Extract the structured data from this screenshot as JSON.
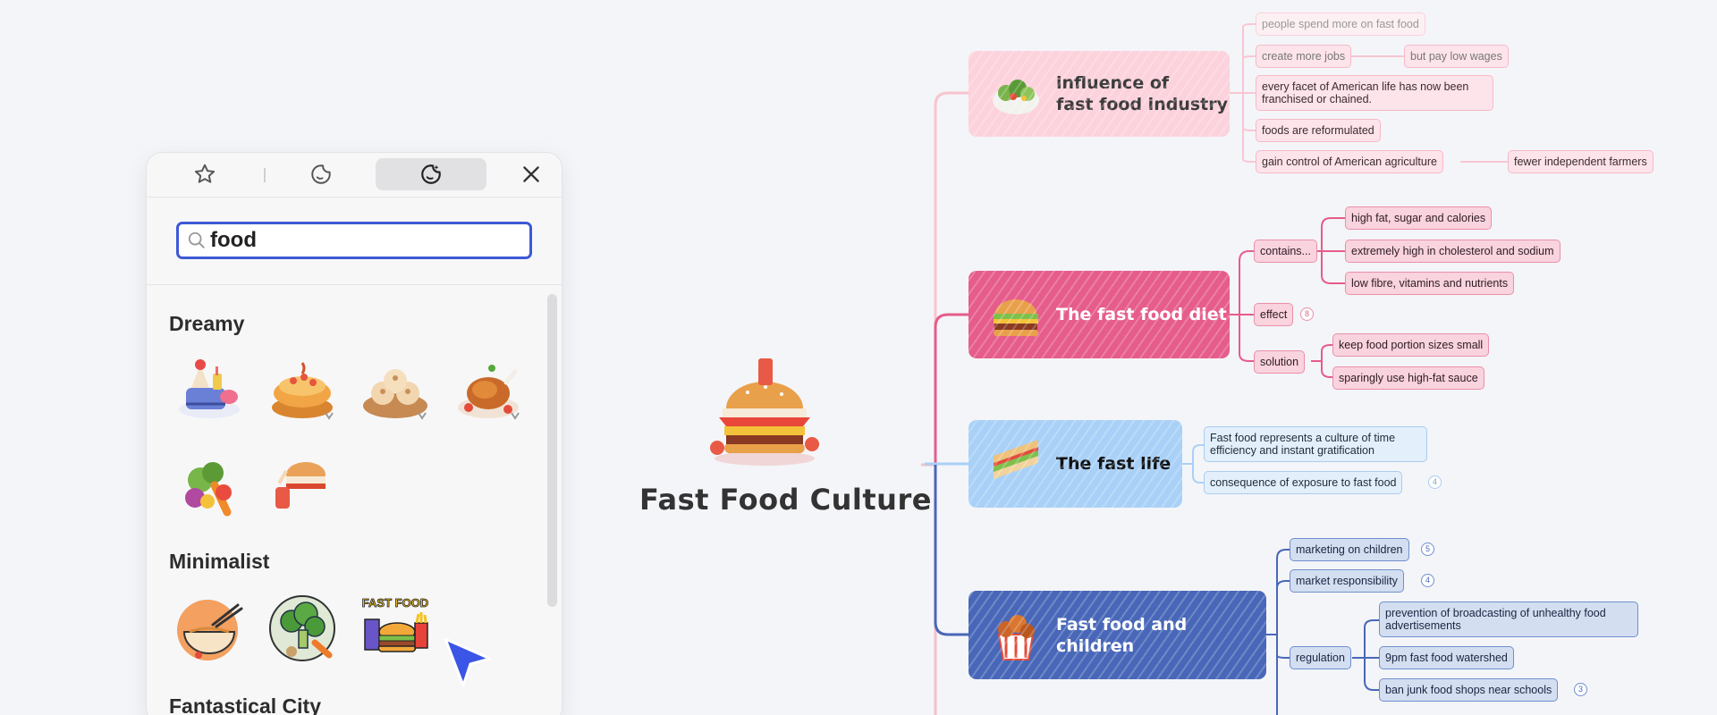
{
  "panel": {
    "tabs": [
      {
        "icon": "star-icon",
        "active": false
      },
      {
        "icon": "sticker-icon",
        "active": false
      },
      {
        "icon": "ai-sticker-icon",
        "active": true
      }
    ],
    "close_icon": "close-icon",
    "search": {
      "value": "food",
      "icon": "search-icon"
    },
    "sections": [
      {
        "title": "Dreamy",
        "stickers": [
          "ice-cream-sundae",
          "fruit-tart",
          "steamed-buns",
          "roast-chicken",
          "vegetables",
          "burger-feast"
        ]
      },
      {
        "title": "Minimalist",
        "stickers": [
          "noodle-bowl",
          "broccoli",
          "fast-food-combo"
        ]
      },
      {
        "title": "Fantastical City",
        "stickers": []
      }
    ],
    "fast_food_sticker_text": "FAST FOOD"
  },
  "mindmap": {
    "central_topic": "Fast Food Culture",
    "topics": [
      {
        "label_line1": "influence of",
        "label_line2": "fast food industry",
        "children": [
          "people spend more on fast food",
          "create more jobs",
          "but pay low wages",
          "every facet of American life has now been franchised or chained.",
          "foods are reformulated",
          "gain control of American agriculture",
          "fewer independent farmers"
        ]
      },
      {
        "label": "The fast food diet",
        "children": {
          "contains": "contains...",
          "contains_items": [
            "high fat, sugar and calories",
            "extremely high in cholesterol and sodium",
            "low fibre, vitamins and nutrients"
          ],
          "effect": "effect",
          "effect_count": "8",
          "solution": "solution",
          "solution_items": [
            "keep food portion sizes small",
            "sparingly use high-fat sauce"
          ]
        }
      },
      {
        "label": "The fast life",
        "children": [
          "Fast food represents a culture of time efficiency and instant gratification",
          "consequence of exposure to fast food"
        ],
        "consequence_count": "4"
      },
      {
        "label": "Fast food and children",
        "children": {
          "marketing": "marketing on children",
          "marketing_count": "5",
          "market_resp": "market responsibility",
          "market_resp_count": "4",
          "regulation": "regulation",
          "regulation_items": [
            "prevention of broadcasting of unhealthy food advertisements",
            "9pm fast food watershed",
            "ban junk food shops near schools"
          ],
          "ban_count": "3"
        }
      }
    ]
  },
  "colors": {
    "accent_blue": "#3d59d6",
    "topic_pink": "#fcd2dc",
    "topic_rose": "#e65c8a",
    "topic_light_blue": "#a9d1f7",
    "topic_dark_blue": "#4867b8"
  }
}
